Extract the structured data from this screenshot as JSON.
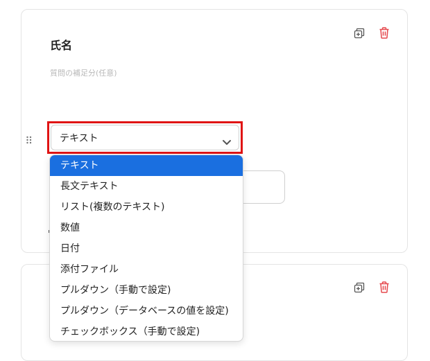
{
  "field1": {
    "title": "氏名",
    "description_placeholder": "質問の補足分(任意)",
    "type_select": {
      "selected": "テキスト"
    }
  },
  "dropdown": {
    "options": [
      "テキスト",
      "長文テキスト",
      "リスト(複数のテキスト)",
      "数値",
      "日付",
      "添付ファイル",
      "プルダウン（手動で設定)",
      "プルダウン（データベースの値を設定)",
      "チェックボックス（手動で設定)"
    ],
    "selected_index": 0
  },
  "icons": {
    "copy": "copy-icon",
    "delete": "trash-icon",
    "drag": "drag-handle-icon",
    "chevron": "chevron-down-icon"
  },
  "colors": {
    "accent_blue": "#1a6fe0",
    "delete_red": "#e5484d",
    "highlight_red": "#e01414"
  }
}
